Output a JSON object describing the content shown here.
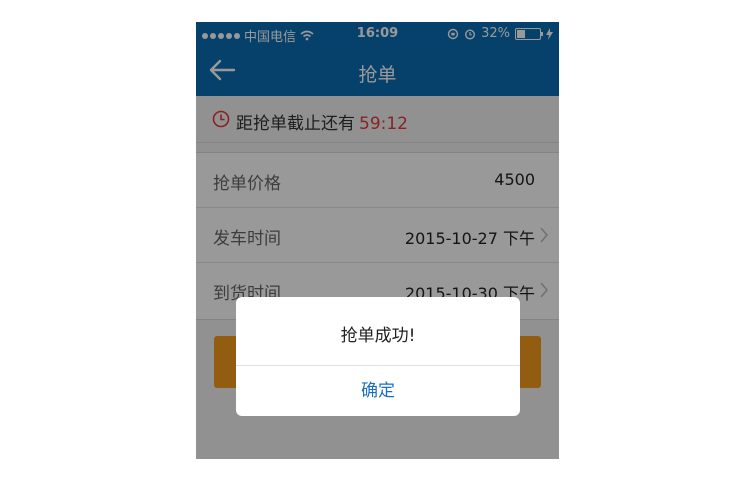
{
  "status_bar": {
    "carrier": "中国电信",
    "time": "16:09",
    "battery": "32%"
  },
  "nav": {
    "title": "抢单"
  },
  "deadline": {
    "text": "距抢单截止还有",
    "countdown": "59:12"
  },
  "form": {
    "rows": [
      {
        "label": "抢单价格",
        "value": "4500"
      },
      {
        "label": "发车时间",
        "value": "2015-10-27 下午"
      },
      {
        "label": "到货时间",
        "value": "2015-10-30 下午"
      }
    ]
  },
  "dialog": {
    "message": "抢单成功!",
    "confirm_label": "确定"
  },
  "colors": {
    "primary": "#0a6db4",
    "countdown": "#e53b3b",
    "submit_button": "#f39b1c",
    "dialog_button_text": "#1a6fc2"
  }
}
